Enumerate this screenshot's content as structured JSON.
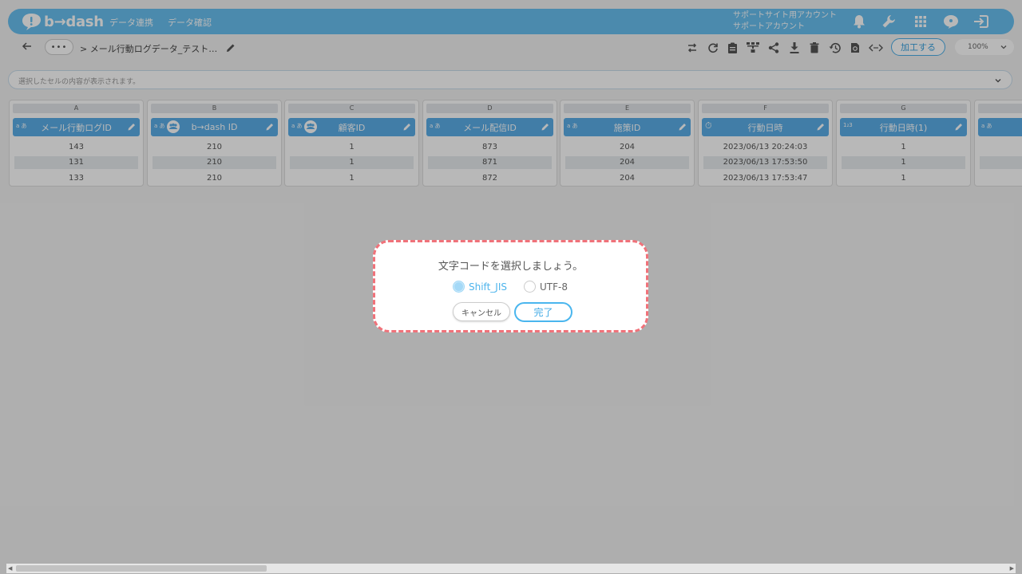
{
  "header": {
    "logo_text": "b→dash",
    "nav": [
      "データ連携",
      "データ確認"
    ],
    "account_line1": "サポートサイト用アカウント",
    "account_line2": "サポートアカウント",
    "brand_color": "#68bff0"
  },
  "toolbar": {
    "more_label": "•••",
    "breadcrumb": "> メール行動ログデータ_テスト…",
    "process_button": "加工する",
    "zoom": "100%"
  },
  "cell_display": {
    "placeholder": "選択したセルの内容が表示されます。"
  },
  "columns": [
    {
      "letter": "A",
      "name": "メール行動ログID",
      "type_icon": "text-type",
      "group": false,
      "cells": [
        "143",
        "131",
        "133"
      ]
    },
    {
      "letter": "B",
      "name": "b→dash ID",
      "type_icon": "text-type",
      "group": true,
      "cells": [
        "210",
        "210",
        "210"
      ]
    },
    {
      "letter": "C",
      "name": "顧客ID",
      "type_icon": "text-type",
      "group": true,
      "cells": [
        "1",
        "1",
        "1"
      ]
    },
    {
      "letter": "D",
      "name": "メール配信ID",
      "type_icon": "text-type",
      "group": false,
      "cells": [
        "873",
        "871",
        "872"
      ]
    },
    {
      "letter": "E",
      "name": "施策ID",
      "type_icon": "text-type",
      "group": false,
      "cells": [
        "204",
        "204",
        "204"
      ]
    },
    {
      "letter": "F",
      "name": "行動日時",
      "type_icon": "datetime-type",
      "group": false,
      "cells": [
        "2023/06/13 20:24:03",
        "2023/06/13 17:53:50",
        "2023/06/13 17:53:47"
      ]
    },
    {
      "letter": "G",
      "name": "行動日時(1)",
      "type_icon": "number-type",
      "group": false,
      "cells": [
        "1",
        "1",
        "1"
      ]
    }
  ],
  "dialog": {
    "title": "文字コードを選択しましょう。",
    "options": [
      {
        "label": "Shift_JIS",
        "selected": true
      },
      {
        "label": "UTF-8",
        "selected": false
      }
    ],
    "cancel_label": "キャンセル",
    "done_label": "完了",
    "highlight_color": "#f0727a"
  }
}
